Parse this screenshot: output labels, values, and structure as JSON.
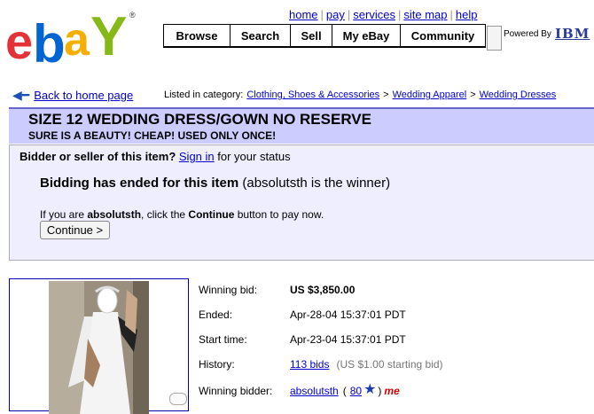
{
  "header": {
    "top_links": [
      "home",
      "pay",
      "services",
      "site map",
      "help"
    ],
    "nav": [
      "Browse",
      "Search",
      "Sell",
      "My eBay",
      "Community"
    ],
    "powered_by": "Powered By",
    "powered_by_brand": "IBM"
  },
  "breadcrumb": {
    "back_label": "Back to home page",
    "listed_label": "Listed in category:",
    "categories": [
      "Clothing, Shoes & Accessories",
      "Wedding Apparel",
      "Wedding Dresses"
    ]
  },
  "item": {
    "title": "SIZE 12 WEDDING DRESS/GOWN NO RESERVE",
    "subtitle": "SURE IS A BEAUTY! CHEAP! USED ONLY ONCE!"
  },
  "status": {
    "question": "Bidder or seller of this item?",
    "sign_in": "Sign in",
    "question_suffix": "for your status",
    "ended_heading": "Bidding has ended for this item",
    "ended_winner_note": "(absolutsth is the winner)",
    "pay_prefix": "If you are",
    "pay_user": "absolutsth",
    "pay_mid": ", click the",
    "pay_continue_word": "Continue",
    "pay_suffix": "button to pay now.",
    "continue_button": "Continue >"
  },
  "details": {
    "winning_bid_label": "Winning bid:",
    "winning_bid_value": "US $3,850.00",
    "ended_label": "Ended:",
    "ended_value": "Apr-28-04 15:37:01 PDT",
    "start_label": "Start time:",
    "start_value": "Apr-23-04 15:37:01 PDT",
    "history_label": "History:",
    "history_link": "113 bids",
    "history_note": "(US $1.00 starting bid)",
    "winner_label": "Winning bidder:",
    "winner_name": "absolutsth",
    "winner_open": "(",
    "winner_score": "80",
    "winner_close": ")",
    "me_badge": "me"
  },
  "colors": {
    "ebay_e": "#e53238",
    "ebay_b": "#0064d2",
    "ebay_a": "#f5af02",
    "ebay_y": "#86b817",
    "title_bar": "#ccccff",
    "status_bg": "#eeeeff",
    "link": "#0000cc"
  },
  "icons": [
    "ebay-logo",
    "back-arrow-icon",
    "powered-by-icon",
    "star-icon",
    "me-badge",
    "zoom-icon"
  ]
}
